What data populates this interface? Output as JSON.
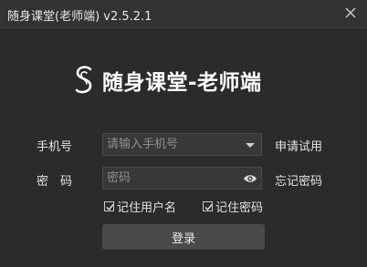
{
  "window": {
    "title": "随身课堂(老师端) v2.5.2.1",
    "close_icon": "close-icon"
  },
  "logo": {
    "mark_icon": "logo-s-icon",
    "app_name": "随身课堂-老师端"
  },
  "form": {
    "phone": {
      "label": "手机号",
      "placeholder": "请输入手机号",
      "value": "",
      "dropdown_icon": "chevron-down-icon"
    },
    "password": {
      "label": "密　码",
      "placeholder": "密码",
      "value": "",
      "toggle_icon": "eye-icon"
    },
    "apply_trial_link": "申请试用",
    "forgot_password_link": "忘记密码",
    "remember_username": {
      "label": "记住用户名",
      "checked": true
    },
    "remember_password": {
      "label": "记住密码",
      "checked": true
    },
    "login_button": "登录"
  },
  "colors": {
    "background": "#2b2b2b",
    "titlebar": "#333333",
    "field_background": "#383838",
    "button_background": "#4a4a4a",
    "text": "#e4e4e4"
  }
}
